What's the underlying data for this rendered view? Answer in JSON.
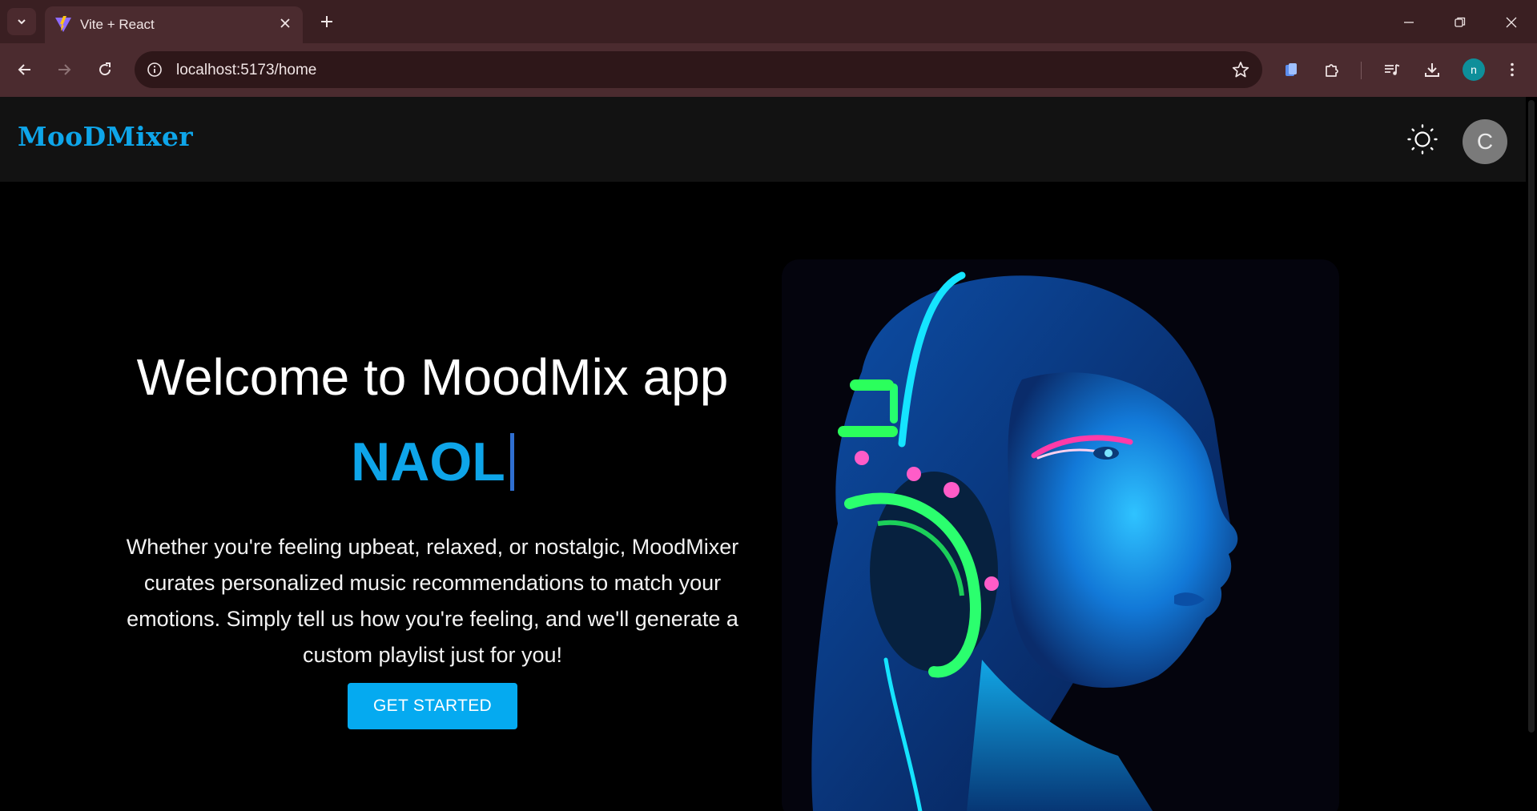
{
  "browser": {
    "tab_title": "Vite + React",
    "url": "localhost:5173/home",
    "profile_initial": "n"
  },
  "app": {
    "logo": "MooDMixer",
    "avatar_initial": "C",
    "theme_icon": "sun-icon"
  },
  "hero": {
    "welcome": "Welcome to MoodMix app",
    "user_name": "NAOL",
    "description": "Whether you're feeling upbeat, relaxed, or nostalgic, MoodMixer curates personalized music recommendations to match your emotions. Simply tell us how you're feeling, and we'll generate a custom playlist just for you!",
    "cta_label": "GET STARTED"
  },
  "colors": {
    "accent": "#0ea5e9",
    "button": "#05aaf0",
    "tab_bar": "#3a1f22",
    "toolbar": "#4b2b2f",
    "header_bg": "#121212"
  }
}
